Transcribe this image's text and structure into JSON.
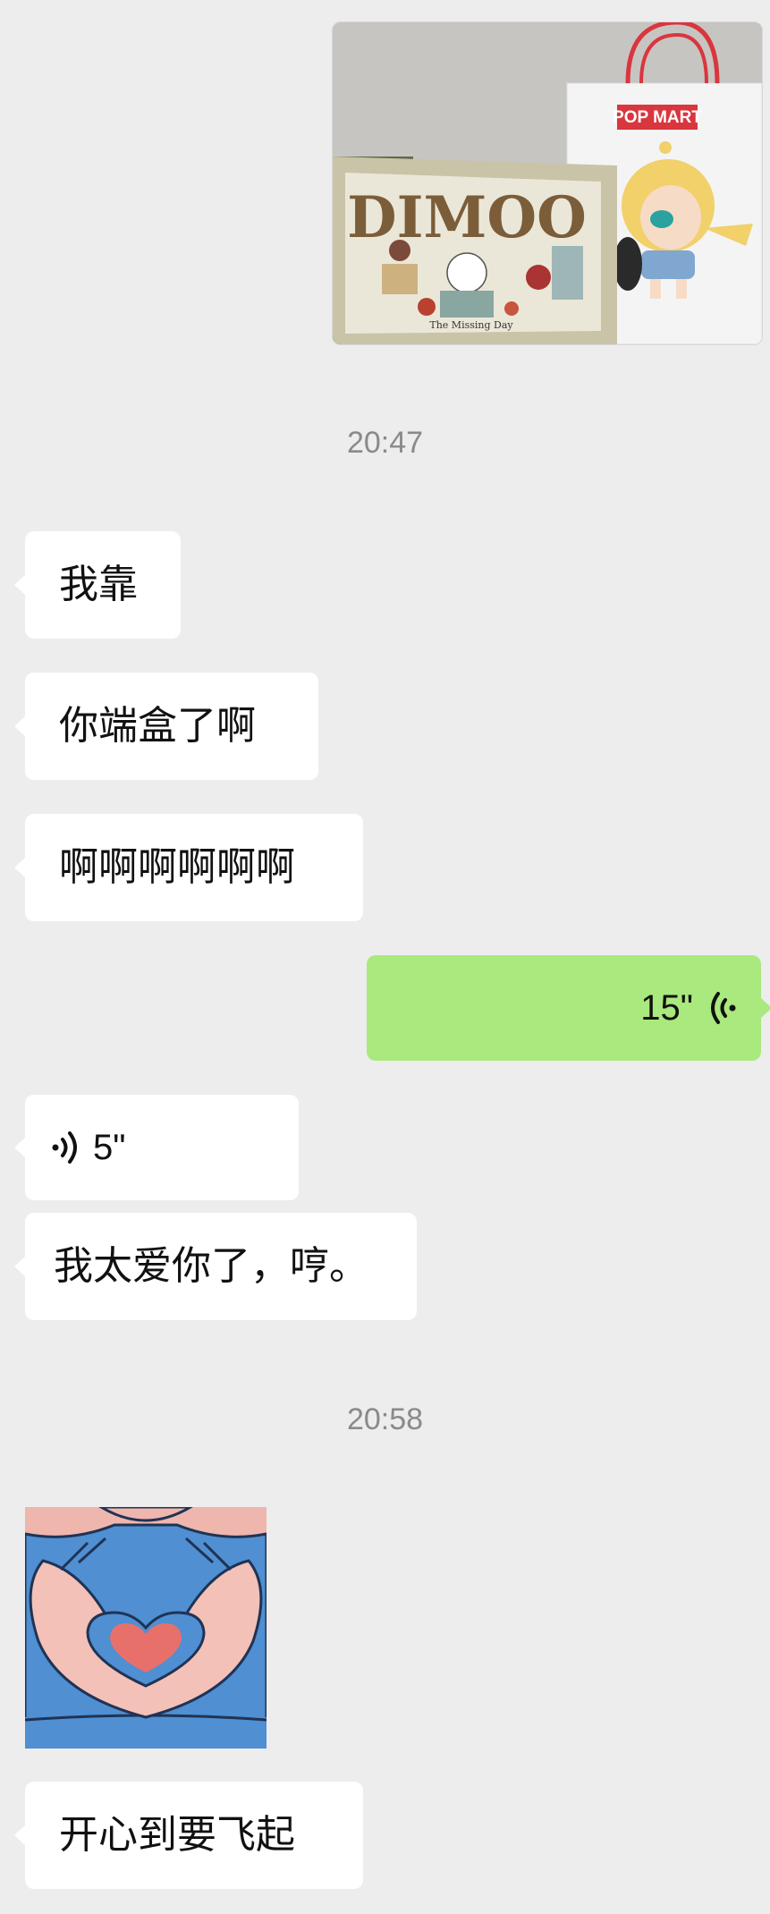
{
  "timestamps": {
    "first": "20:47",
    "second": "20:58"
  },
  "photo_message": {
    "bag_brand": "POP MART",
    "box_title": "DIMOO",
    "box_subtitle": "The Missing Day"
  },
  "messages": [
    {
      "side": "in",
      "type": "text",
      "text": "我靠"
    },
    {
      "side": "in",
      "type": "text",
      "text": "你端盒了啊"
    },
    {
      "side": "in",
      "type": "text",
      "text": "啊啊啊啊啊啊"
    },
    {
      "side": "out",
      "type": "voice",
      "duration": "15\""
    },
    {
      "side": "in",
      "type": "voice",
      "duration": "5\""
    },
    {
      "side": "in",
      "type": "text",
      "text": "我太爱你了，哼。"
    },
    {
      "side": "in",
      "type": "sticker",
      "sticker": "heart-hands"
    },
    {
      "side": "in",
      "type": "text",
      "text": "开心到要飞起"
    }
  ],
  "colors": {
    "background": "#ededed",
    "incoming_bubble": "#ffffff",
    "outgoing_bubble": "#a9e97d",
    "timestamp_text": "#8a8a8a"
  },
  "icons": {
    "voice_outgoing": "voice-wave-icon",
    "voice_incoming": "voice-wave-icon"
  }
}
